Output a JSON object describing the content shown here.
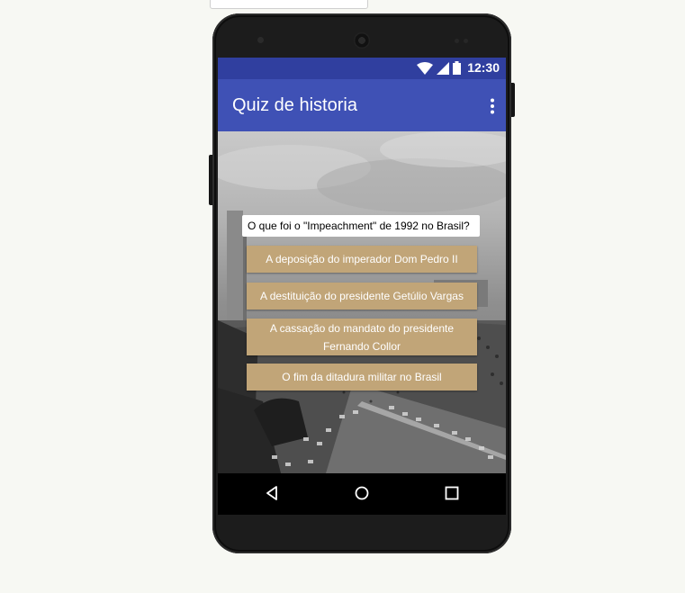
{
  "status_bar": {
    "time": "12:30",
    "icons": [
      "wifi-icon",
      "cell-signal-icon",
      "battery-icon"
    ]
  },
  "app_bar": {
    "title": "Quiz de historia",
    "menu_icon": "more-vert-icon"
  },
  "quiz": {
    "question": "O que foi o \"Impeachment\" de 1992 no Brasil?",
    "answers": [
      "A deposição do imperador Dom Pedro II",
      "A destituição do presidente Getúlio Vargas",
      "A cassação do mandato do presidente Fernando Collor",
      "O fim da ditadura militar no Brasil"
    ]
  },
  "nav_bar": {
    "icons": [
      "back-icon",
      "home-icon",
      "recents-icon"
    ]
  },
  "colors": {
    "status_bar": "#303f9f",
    "app_bar": "#3f51b5",
    "answer_button": "#c1a578",
    "page_background": "#f7f8f3"
  }
}
